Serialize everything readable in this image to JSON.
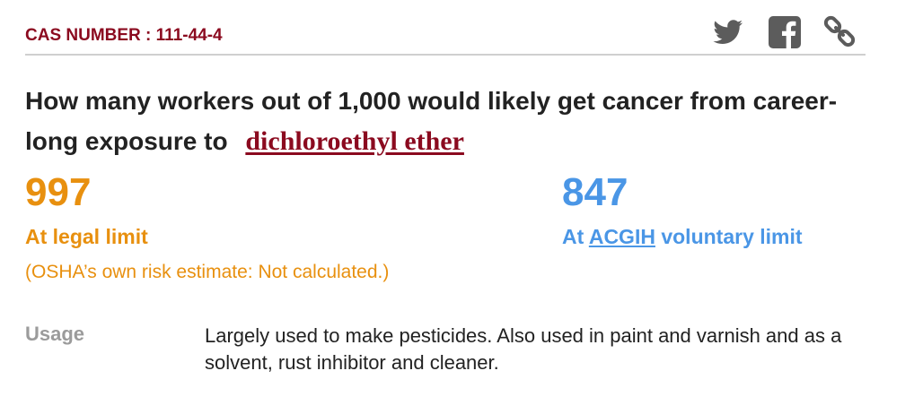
{
  "header": {
    "cas_label": "CAS NUMBER : 111-44-4",
    "share_icons": [
      "twitter-icon",
      "facebook-icon",
      "link-icon"
    ],
    "icon_color": "#5c5c5c"
  },
  "question": {
    "text": "How many workers out of 1,000 would likely get cancer from career-long exposure to",
    "chemical": "dichloroethyl ether"
  },
  "legal": {
    "value": "997",
    "label": "At legal limit",
    "note": "(OSHA’s own risk estimate: Not calculated.)"
  },
  "voluntary": {
    "value": "847",
    "prefix": "At",
    "org": "ACGIH",
    "suffix": "voluntary limit"
  },
  "usage": {
    "label": "Usage",
    "text": "Largely used to make pesticides. Also used in paint and varnish and as a solvent, rust inhibitor and cleaner."
  },
  "colors": {
    "brand_red": "#8b0a1f",
    "orange": "#e8900f",
    "blue": "#4a96e6",
    "gray": "#9b9b9b"
  }
}
